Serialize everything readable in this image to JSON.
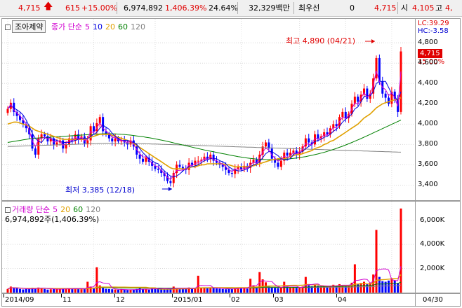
{
  "quote": {
    "price": "4,715",
    "change": "615",
    "change_pct": "+15.00%",
    "volume": "6,974,892",
    "volume_ratio": "1,406.39%",
    "turnover_pct": "24.64%",
    "trade_value": "32,329백만",
    "pref_label": "최우선",
    "pref_value": "0",
    "best_price": "4,715",
    "open_label": "시",
    "open": "4,105",
    "high_label": "고",
    "high": "4,"
  },
  "price_chart": {
    "stock_name": "조아제약",
    "legend_label": "종가 단순",
    "ma": [
      {
        "period": "5",
        "color": "#d000d0"
      },
      {
        "period": "10",
        "color": "#0000e0"
      },
      {
        "period": "20",
        "color": "#e0a000"
      },
      {
        "period": "60",
        "color": "#008000"
      },
      {
        "period": "120",
        "color": "#808080"
      }
    ],
    "lc": "LC:39.29",
    "hc": "HC:-3.58",
    "last_price_tag": "4,715",
    "last_pct": "15.00%",
    "high_annotation": "최고 4,890 (04/21)",
    "low_annotation": "최저 3,385 (12/18)",
    "y_ticks": [
      "4,800",
      "4,600",
      "4,400",
      "4,200",
      "4,000",
      "3,800",
      "3,600",
      "3,400"
    ],
    "ylim": [
      3300,
      4980
    ]
  },
  "volume_chart": {
    "legend_label": "거래량 단순",
    "ma": [
      {
        "period": "5",
        "color": "#d000d0"
      },
      {
        "period": "20",
        "color": "#e0a000"
      },
      {
        "period": "60",
        "color": "#008000"
      },
      {
        "period": "120",
        "color": "#808080"
      }
    ],
    "current": "6,974,892주(1,406.39%)",
    "y_ticks": [
      "6,000K",
      "4,000K",
      "2,000K"
    ],
    "ylim": [
      0,
      7200
    ]
  },
  "x_axis": {
    "labels": [
      "2014/09",
      "11",
      "12",
      "2015/01",
      "02",
      "03",
      "04",
      "04/30"
    ]
  },
  "chart_data": {
    "type": "candlestick",
    "close": [
      4150,
      4210,
      4120,
      4080,
      4040,
      4000,
      3960,
      3900,
      3760,
      3700,
      3860,
      3900,
      3880,
      3830,
      3860,
      3800,
      3820,
      3840,
      3760,
      3800,
      3860,
      3840,
      3900,
      3850,
      3880,
      3810,
      3840,
      3980,
      3930,
      4010,
      4070,
      3930,
      3900,
      3860,
      3830,
      3860,
      3830,
      3840,
      3820,
      3800,
      3840,
      3780,
      3700,
      3660,
      3630,
      3670,
      3630,
      3590,
      3560,
      3550,
      3520,
      3490,
      3440,
      3420,
      3520,
      3600,
      3580,
      3560,
      3550,
      3620,
      3600,
      3640,
      3640,
      3650,
      3680,
      3660,
      3700,
      3640,
      3620,
      3600,
      3580,
      3550,
      3520,
      3510,
      3560,
      3580,
      3560,
      3590,
      3570,
      3620,
      3650,
      3620,
      3700,
      3780,
      3820,
      3760,
      3660,
      3620,
      3580,
      3640,
      3720,
      3690,
      3720,
      3740,
      3700,
      3730,
      3780,
      3860,
      3820,
      3800,
      3900,
      3860,
      3880,
      3920,
      3900,
      3960,
      4000,
      3980,
      4070,
      4120,
      4060,
      4100,
      4200,
      4270,
      4220,
      4290,
      4350,
      4250,
      4300,
      4450,
      4650,
      4420,
      4300,
      4260,
      4200,
      4320,
      4250,
      4120,
      4715
    ],
    "volume_k": [
      300,
      500,
      400,
      350,
      300,
      260,
      300,
      320,
      400,
      350,
      420,
      380,
      300,
      250,
      280,
      300,
      320,
      280,
      300,
      320,
      350,
      300,
      360,
      300,
      280,
      300,
      900,
      500,
      400,
      2100,
      600,
      400,
      320,
      300,
      280,
      260,
      240,
      260,
      240,
      220,
      240,
      260,
      300,
      350,
      280,
      260,
      240,
      380,
      420,
      300,
      280,
      320,
      300,
      280,
      500,
      380,
      360,
      320,
      300,
      420,
      380,
      350,
      1400,
      400,
      380,
      360,
      420,
      380,
      340,
      320,
      300,
      280,
      320,
      300,
      360,
      400,
      380,
      350,
      330,
      1150,
      600,
      480,
      1700,
      1100,
      850,
      500,
      420,
      400,
      380,
      420,
      900,
      480,
      450,
      420,
      400,
      420,
      500,
      1300,
      600,
      520,
      620,
      560,
      520,
      540,
      480,
      550,
      650,
      560,
      700,
      620,
      560,
      640,
      820,
      2350,
      720,
      800,
      900,
      700,
      820,
      1500,
      5200,
      1300,
      950,
      900,
      1000,
      1200,
      1000,
      800,
      6975
    ],
    "ma5_price": [
      4150,
      4180,
      4160,
      4140,
      4120,
      4090,
      4040,
      3980,
      3910,
      3860,
      3830,
      3820,
      3860,
      3880,
      3860,
      3850,
      3840,
      3830,
      3820,
      3820,
      3820,
      3830,
      3840,
      3850,
      3860,
      3860,
      3860,
      3880,
      3900,
      3920,
      3960,
      3990,
      3970,
      3950,
      3910,
      3880,
      3860,
      3840,
      3840,
      3840,
      3830,
      3820,
      3800,
      3760,
      3720,
      3690,
      3660,
      3640,
      3620,
      3610,
      3570,
      3540,
      3510,
      3490,
      3480,
      3490,
      3510,
      3540,
      3560,
      3580,
      3580,
      3590,
      3600,
      3620,
      3640,
      3650,
      3660,
      3660,
      3660,
      3640,
      3630,
      3610,
      3580,
      3560,
      3550,
      3540,
      3540,
      3550,
      3560,
      3580,
      3600,
      3610,
      3630,
      3670,
      3710,
      3730,
      3730,
      3710,
      3690,
      3660,
      3650,
      3650,
      3660,
      3700,
      3720,
      3720,
      3730,
      3760,
      3780,
      3800,
      3830,
      3840,
      3850,
      3870,
      3880,
      3900,
      3930,
      3950,
      3980,
      4020,
      4050,
      4070,
      4100,
      4150,
      4170,
      4220,
      4270,
      4280,
      4280,
      4320,
      4400,
      4420,
      4420,
      4420,
      4360,
      4300,
      4270,
      4230,
      4320
    ],
    "ma20_price": [
      4000,
      4010,
      4020,
      4020,
      4010,
      4000,
      3990,
      3980,
      3960,
      3940,
      3930,
      3920,
      3910,
      3900,
      3890,
      3880,
      3870,
      3860,
      3850,
      3850,
      3850,
      3850,
      3850,
      3850,
      3850,
      3850,
      3860,
      3870,
      3880,
      3890,
      3900,
      3900,
      3900,
      3900,
      3890,
      3880,
      3870,
      3860,
      3850,
      3840,
      3830,
      3810,
      3790,
      3770,
      3750,
      3730,
      3710,
      3690,
      3670,
      3650,
      3630,
      3610,
      3590,
      3570,
      3560,
      3560,
      3560,
      3560,
      3560,
      3570,
      3580,
      3580,
      3590,
      3600,
      3600,
      3610,
      3610,
      3610,
      3610,
      3610,
      3610,
      3600,
      3600,
      3590,
      3580,
      3580,
      3580,
      3580,
      3580,
      3590,
      3590,
      3600,
      3610,
      3620,
      3630,
      3640,
      3650,
      3650,
      3660,
      3660,
      3660,
      3670,
      3680,
      3690,
      3700,
      3700,
      3710,
      3720,
      3730,
      3740,
      3760,
      3770,
      3780,
      3800,
      3810,
      3830,
      3840,
      3860,
      3880,
      3900,
      3920,
      3940,
      3960,
      3980,
      4000,
      4030,
      4060,
      4080,
      4100,
      4130,
      4160,
      4180,
      4200,
      4210,
      4220,
      4230,
      4240,
      4240,
      4260
    ],
    "ma60_price": [
      3820,
      3825,
      3830,
      3835,
      3840,
      3845,
      3850,
      3855,
      3860,
      3862,
      3864,
      3866,
      3868,
      3870,
      3872,
      3874,
      3876,
      3878,
      3880,
      3882,
      3884,
      3886,
      3888,
      3890,
      3892,
      3894,
      3896,
      3898,
      3900,
      3902,
      3904,
      3905,
      3906,
      3906,
      3905,
      3904,
      3902,
      3900,
      3898,
      3895,
      3892,
      3888,
      3884,
      3880,
      3876,
      3871,
      3866,
      3861,
      3855,
      3849,
      3843,
      3837,
      3830,
      3823,
      3816,
      3809,
      3802,
      3795,
      3788,
      3781,
      3774,
      3767,
      3760,
      3753,
      3746,
      3740,
      3734,
      3728,
      3722,
      3716,
      3710,
      3704,
      3698,
      3692,
      3686,
      3681,
      3676,
      3671,
      3667,
      3663,
      3660,
      3657,
      3655,
      3653,
      3652,
      3651,
      3651,
      3651,
      3652,
      3653,
      3655,
      3657,
      3660,
      3663,
      3667,
      3671,
      3676,
      3681,
      3687,
      3693,
      3700,
      3707,
      3715,
      3723,
      3732,
      3741,
      3751,
      3761,
      3772,
      3783,
      3795,
      3807,
      3819,
      3832,
      3845,
      3858,
      3872,
      3886,
      3900,
      3914,
      3928,
      3942,
      3956,
      3970,
      3984,
      3998,
      4012,
      4026,
      4040
    ],
    "ma120_price": [
      3780,
      3781,
      3782,
      3783,
      3784,
      3785,
      3786,
      3787,
      3788,
      3789,
      3790,
      3791,
      3792,
      3793,
      3794,
      3795,
      3796,
      3797,
      3798,
      3799,
      3800,
      3801,
      3802,
      3803,
      3804,
      3805,
      3806,
      3807,
      3808,
      3809,
      3810,
      3811,
      3812,
      3812,
      3812,
      3812,
      3812,
      3812,
      3812,
      3812,
      3812,
      3811,
      3810,
      3809,
      3808,
      3807,
      3806,
      3805,
      3804,
      3803,
      3802,
      3801,
      3800,
      3799,
      3798,
      3797,
      3796,
      3795,
      3794,
      3793,
      3792,
      3791,
      3790,
      3789,
      3788,
      3787,
      3786,
      3785,
      3784,
      3783,
      3782,
      3781,
      3780,
      3779,
      3778,
      3777,
      3776,
      3775,
      3774,
      3773,
      3772,
      3771,
      3770,
      3769,
      3768,
      3767,
      3766,
      3765,
      3764,
      3763,
      3762,
      3761,
      3760,
      3759,
      3758,
      3757,
      3756,
      3755,
      3754,
      3753,
      3752,
      3751,
      3750,
      3749,
      3748,
      3747,
      3746,
      3745,
      3744,
      3743,
      3742,
      3741,
      3740,
      3739,
      3738,
      3737,
      3736,
      3735,
      3734,
      3733,
      3732,
      3731,
      3730,
      3729,
      3728,
      3727,
      3726,
      3725,
      3724
    ]
  }
}
